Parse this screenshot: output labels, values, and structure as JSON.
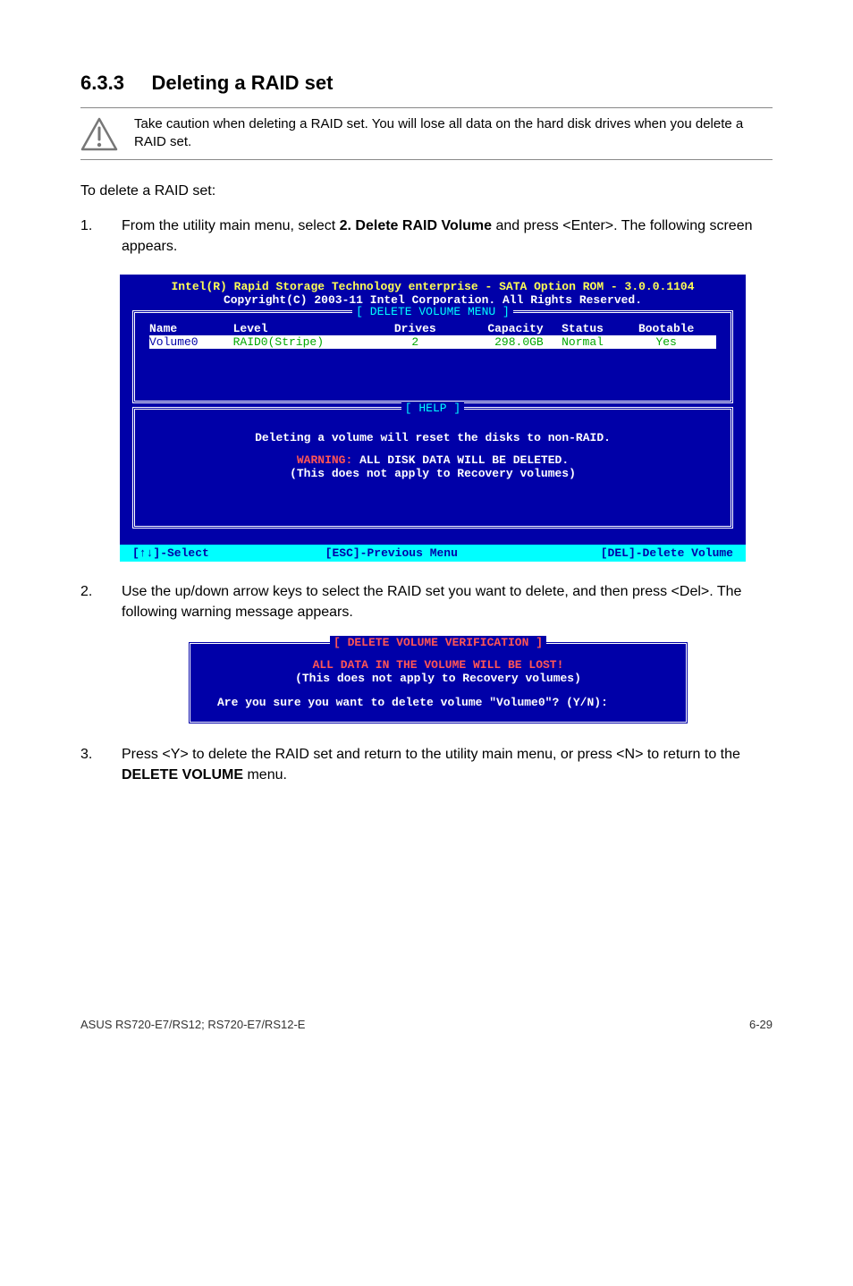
{
  "heading": {
    "number": "6.3.3",
    "title": "Deleting a RAID set"
  },
  "note": "Take caution when deleting a RAID set. You will lose all data on the hard disk drives when you delete a RAID set.",
  "intro": "To delete a RAID set:",
  "steps": {
    "s1": {
      "num": "1.",
      "text_before": "From the utility main menu, select ",
      "bold": "2. Delete RAID Volume",
      "text_after": " and press <Enter>. The following screen appears."
    },
    "s2": {
      "num": "2.",
      "text": "Use the up/down arrow keys to select the RAID set you want to delete, and then press <Del>. The following warning message appears."
    },
    "s3": {
      "num": "3.",
      "text_before": "Press <Y> to delete the RAID set and return to the utility main menu, or press <N> to return to the ",
      "bold": "DELETE VOLUME",
      "text_after": " menu."
    }
  },
  "bios": {
    "title1": "Intel(R) Rapid Storage Technology enterprise - SATA Option ROM - 3.0.0.1104",
    "title2": "Copyright(C) 2003-11 Intel Corporation.  All Rights Reserved.",
    "delete_menu_label": "[ DELETE VOLUME MENU ]",
    "columns": {
      "c1": "Name",
      "c2": "Level",
      "c3": "Drives",
      "c4": "Capacity",
      "c5": "Status",
      "c6": "Bootable"
    },
    "row": {
      "c1": "Volume0",
      "c2": "RAID0(Stripe)",
      "c3": "2",
      "c4": "298.0GB",
      "c5": "Normal",
      "c6": "Yes"
    },
    "help_label": "[ HELP ]",
    "help_line1": "Deleting a volume will reset the disks to non-RAID.",
    "warn_label": "WARNING:",
    "warn_text": " ALL DISK DATA WILL BE DELETED.",
    "help_line3": "(This does not apply to Recovery volumes)",
    "footer": {
      "f1": "[↑↓]-Select",
      "f2": "[ESC]-Previous Menu",
      "f3": "[DEL]-Delete Volume"
    }
  },
  "verify": {
    "label": "[ DELETE VOLUME VERIFICATION ]",
    "line1": "ALL DATA IN THE VOLUME WILL BE LOST!",
    "line2": "(This does not apply to Recovery volumes)",
    "line3": "Are you sure you want to delete volume \"Volume0\"? (Y/N):"
  },
  "footer": {
    "left": "ASUS RS720-E7/RS12; RS720-E7/RS12-E",
    "right": "6-29"
  }
}
